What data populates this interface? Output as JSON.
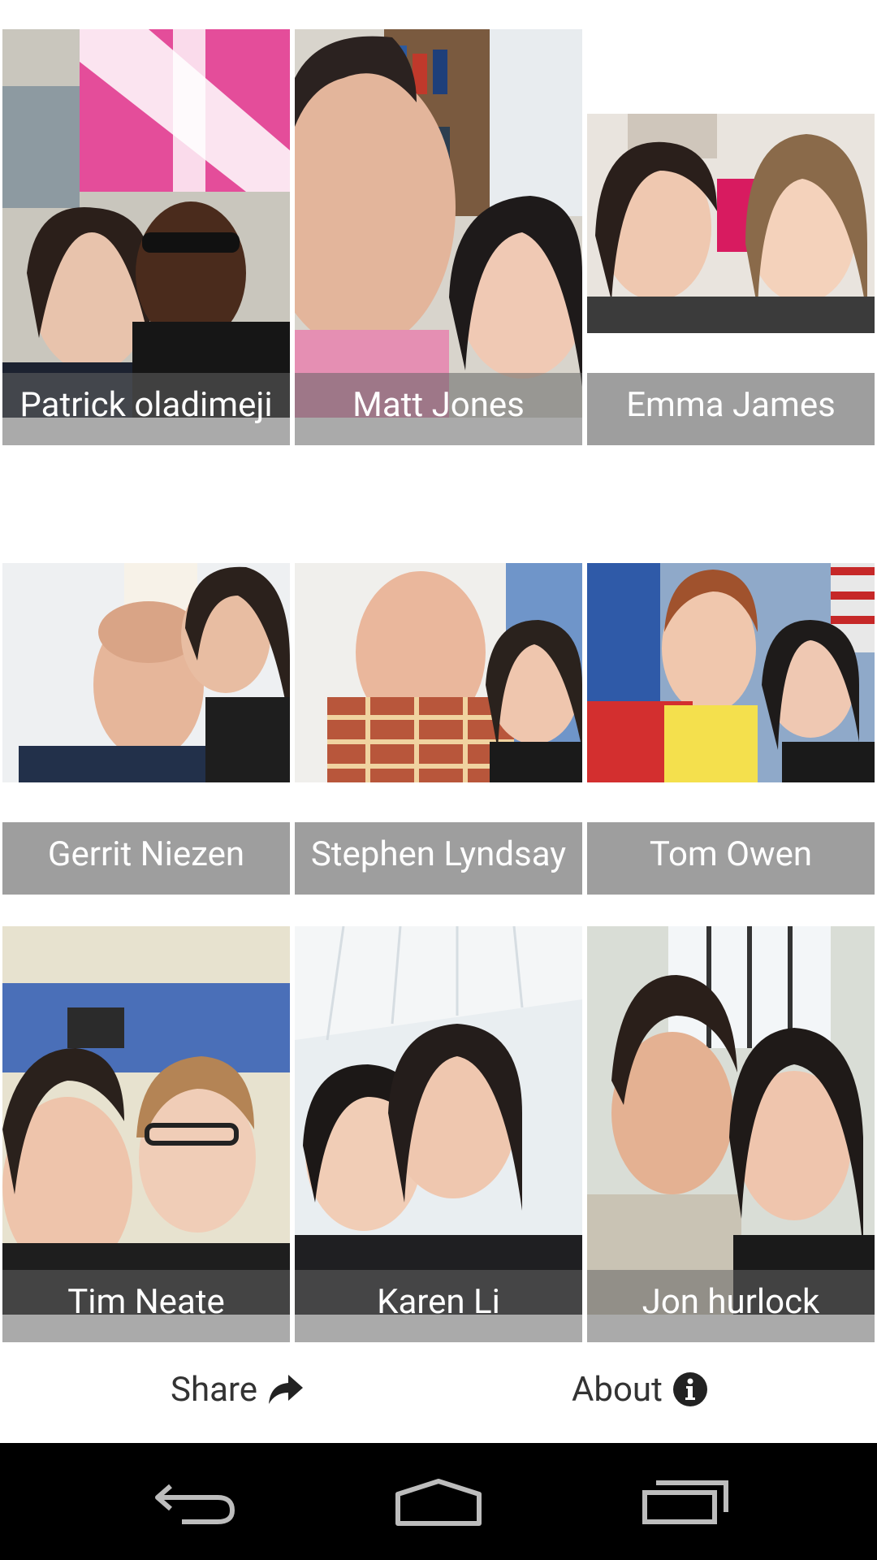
{
  "contacts": [
    {
      "name": "Patrick oladimeji",
      "photo": "selfie-photo"
    },
    {
      "name": "Matt Jones",
      "photo": "selfie-photo"
    },
    {
      "name": "Emma James",
      "photo": "selfie-photo"
    },
    {
      "name": "Gerrit Niezen",
      "photo": "selfie-photo"
    },
    {
      "name": "Stephen Lyndsay",
      "photo": "selfie-photo"
    },
    {
      "name": "Tom Owen",
      "photo": "selfie-photo"
    },
    {
      "name": "Tim Neate",
      "photo": "selfie-photo"
    },
    {
      "name": "Karen Li",
      "photo": "selfie-photo"
    },
    {
      "name": "Jon hurlock",
      "photo": "selfie-photo"
    }
  ],
  "actions": {
    "share_label": "Share",
    "share_icon": "share-arrow-icon",
    "about_label": "About",
    "about_icon": "info-icon"
  },
  "navbar": {
    "back_icon": "back-icon",
    "home_icon": "home-icon",
    "recents_icon": "recents-icon"
  },
  "colors": {
    "name_bar": "#9e9e9e",
    "name_text": "#ffffff",
    "action_text": "#333333",
    "navbar_bg": "#000000",
    "nav_icon": "#bdbdbd"
  }
}
